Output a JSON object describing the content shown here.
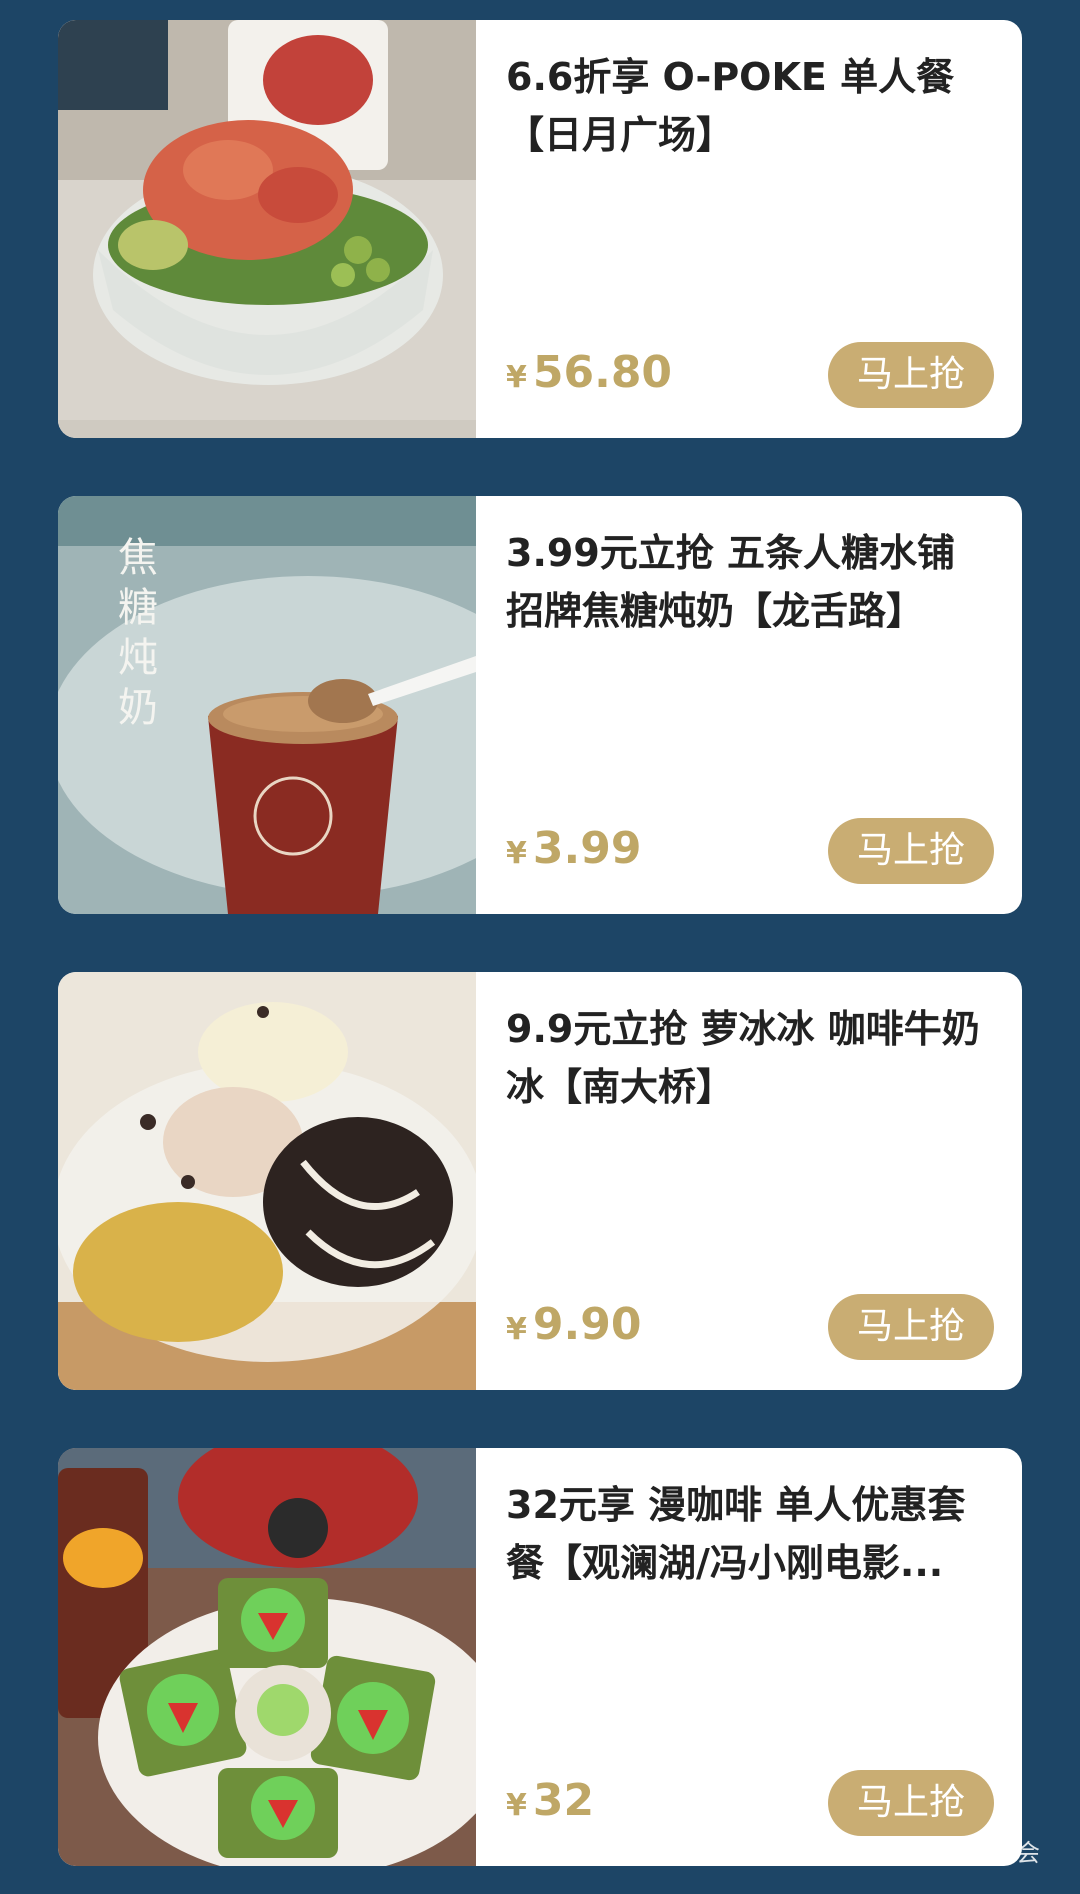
{
  "deals": [
    {
      "image": "poke-bowl-image",
      "title": "6.6折享 O-POKE 单人餐【日月广场】",
      "currency": "¥",
      "price": "56.80",
      "button_label": "马上抢"
    },
    {
      "image": "caramel-milk-pudding-image",
      "image_caption": "焦糖炖奶",
      "title": "3.99元立抢 五条人糖水铺 招牌焦糖炖奶【龙舌路】",
      "currency": "¥",
      "price": "3.99",
      "button_label": "马上抢"
    },
    {
      "image": "coffee-milk-ice-image",
      "title": "9.9元立抢 萝冰冰 咖啡牛奶冰【南大桥】",
      "currency": "¥",
      "price": "9.90",
      "button_label": "马上抢"
    },
    {
      "image": "matcha-waffle-set-image",
      "title": "32元享 漫咖啡 单人优惠套餐【观澜湖/冯小刚电影...",
      "currency": "¥",
      "price": "32",
      "button_label": "马上抢"
    }
  ],
  "watermark": {
    "icon": "wechat-icon",
    "text": "海南省酒店与餐饮行业协会"
  },
  "colors": {
    "background": "#1d4566",
    "card": "#ffffff",
    "price": "#bfa766",
    "button": "#c9ad73"
  }
}
